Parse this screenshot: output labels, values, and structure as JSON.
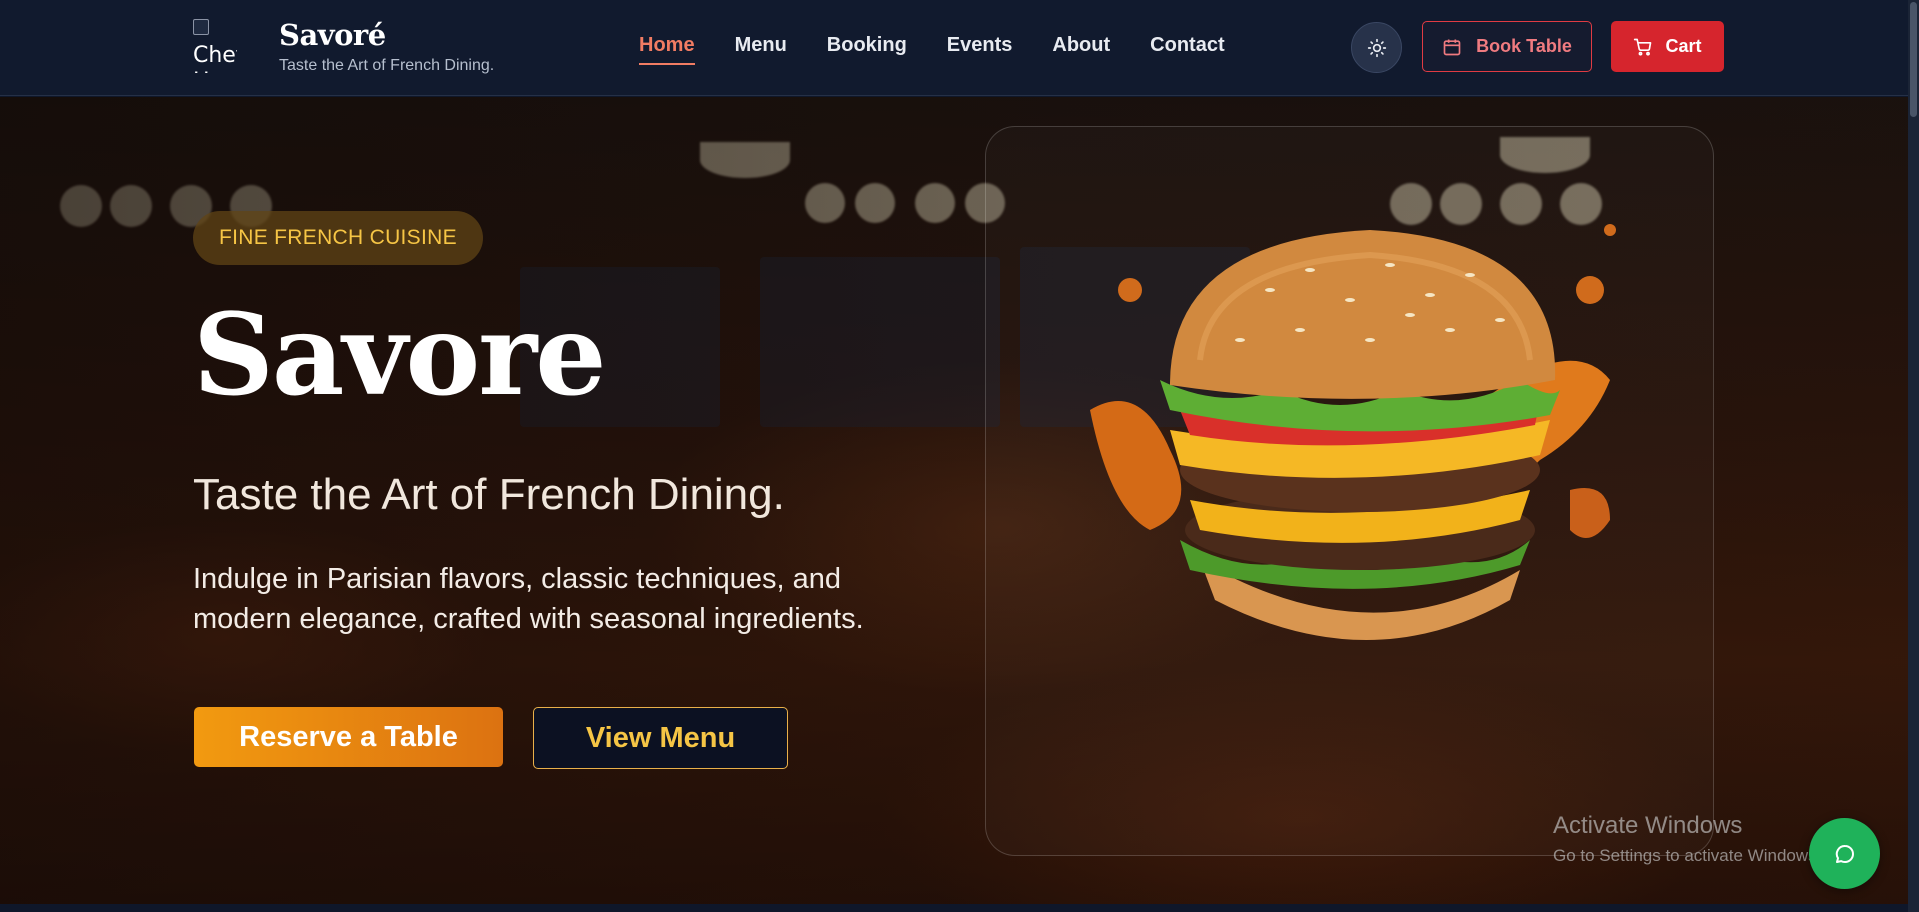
{
  "header": {
    "logo_alt": "Chef H",
    "brand_name": "Savoré",
    "brand_tagline": "Taste the Art of French Dining.",
    "nav": [
      {
        "label": "Home",
        "active": true
      },
      {
        "label": "Menu"
      },
      {
        "label": "Booking"
      },
      {
        "label": "Events"
      },
      {
        "label": "About"
      },
      {
        "label": "Contact"
      }
    ],
    "theme_toggle_icon": "sun-icon",
    "book_table_label": "Book Table",
    "book_table_icon": "calendar-icon",
    "cart_label": "Cart",
    "cart_icon": "cart-icon"
  },
  "hero": {
    "badge": "FINE FRENCH CUISINE",
    "title": "Savore",
    "subtitle": "Taste the Art of French Dining.",
    "description": "Indulge in Parisian flavors, classic techniques, and modern elegance, crafted with seasonal ingredients.",
    "primary_cta": "Reserve a Table",
    "secondary_cta": "View Menu",
    "image_subject": "burger"
  },
  "overlay": {
    "activate_title": "Activate Windows",
    "activate_sub": "Go to Settings to activate Windows."
  },
  "chat": {
    "icon": "chat-icon"
  },
  "colors": {
    "accent": "#f17c63",
    "primary_red": "#d6252d",
    "gold": "#f6c545",
    "orange": "#f29a10",
    "chat_green": "#1fb25a",
    "header_bg": "#111a2e"
  }
}
